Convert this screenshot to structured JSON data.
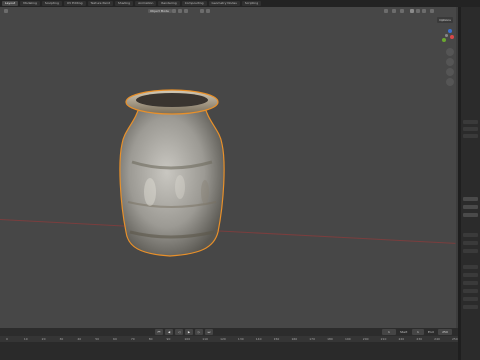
{
  "workspace_tabs": [
    "Layout",
    "Modeling",
    "Sculpting",
    "UV Editing",
    "Texture Paint",
    "Shading",
    "Animation",
    "Rendering",
    "Compositing",
    "Geometry Nodes",
    "Scripting"
  ],
  "viewport": {
    "mode": "Object Mode",
    "options_label": "Options"
  },
  "timeline": {
    "current_frame": "1",
    "start_label": "Start",
    "start_value": "1",
    "end_label": "End",
    "end_value": "250"
  },
  "ruler_ticks": [
    "0",
    "10",
    "20",
    "30",
    "40",
    "50",
    "60",
    "70",
    "80",
    "90",
    "100",
    "110",
    "120",
    "130",
    "140",
    "150",
    "160",
    "170",
    "180",
    "190",
    "200",
    "210",
    "220",
    "230",
    "240",
    "250"
  ],
  "colors": {
    "x_axis": "#a04040",
    "y_axis": "#6a8a30",
    "selection_outline": "#e8902a",
    "viewport_bg": "#474747"
  }
}
